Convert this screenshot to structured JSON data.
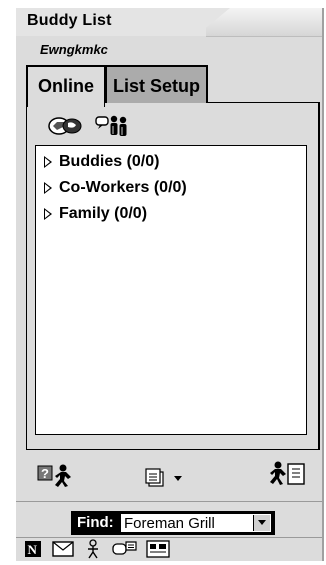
{
  "window": {
    "title": "Buddy List",
    "username": "Ewngkmkc"
  },
  "tabs": [
    {
      "label": "Online",
      "active": true
    },
    {
      "label": "List Setup",
      "active": false
    }
  ],
  "toolbar_top": {
    "icons": [
      "chat-room-icon",
      "buddy-chat-icon"
    ]
  },
  "groups": [
    {
      "label": "Buddies (0/0)"
    },
    {
      "label": "Co-Workers (0/0)"
    },
    {
      "label": "Family (0/0)"
    }
  ],
  "bottom_toolbar": {
    "icons": [
      "get-info-icon",
      "setup-menu-icon",
      "away-message-icon"
    ]
  },
  "find": {
    "label": "Find:",
    "value": "Foreman Grill"
  },
  "footer_icons": [
    "news-icon",
    "mail-icon",
    "buddy-icon",
    "people-connection-icon",
    "sign-on-icon"
  ]
}
